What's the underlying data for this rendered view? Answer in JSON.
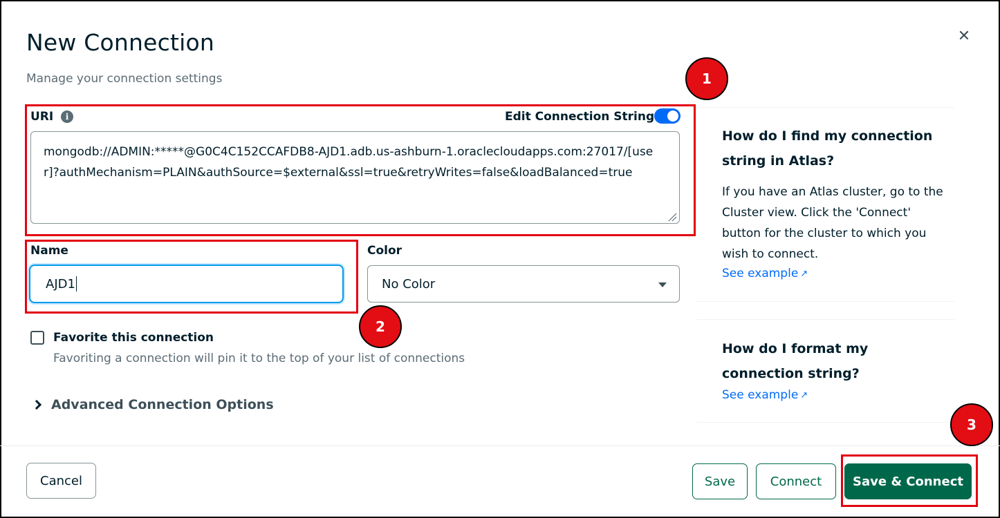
{
  "modal": {
    "title": "New Connection",
    "subtitle": "Manage your connection settings",
    "close_icon": "close-icon"
  },
  "uri": {
    "label": "URI",
    "info_icon": "i",
    "edit_toggle_label": "Edit Connection String",
    "edit_toggle_on": true,
    "value": "mongodb://ADMIN:*****@G0C4C152CCAFDB8-AJD1.adb.us-ashburn-1.oraclecloudapps.com:27017/[user]?authMechanism=PLAIN&authSource=$external&ssl=true&retryWrites=false&loadBalanced=true"
  },
  "name": {
    "label": "Name",
    "value": "AJD1"
  },
  "color": {
    "label": "Color",
    "selected": "No Color"
  },
  "favorite": {
    "label": "Favorite this connection",
    "description": "Favoriting a connection will pin it to the top of your list of connections",
    "checked": false
  },
  "advanced": {
    "label": "Advanced Connection Options"
  },
  "help": [
    {
      "title": "How do I find my connection string in Atlas?",
      "text": "If you have an Atlas cluster, go to the Cluster view. Click the 'Connect' button for the cluster to which you wish to connect.",
      "link": "See example"
    },
    {
      "title": "How do I format my connection string?",
      "link": "See example"
    }
  ],
  "footer": {
    "cancel": "Cancel",
    "save": "Save",
    "connect": "Connect",
    "save_connect": "Save & Connect"
  },
  "annotations": {
    "badge1": "1",
    "badge2": "2",
    "badge3": "3",
    "color": "#e3000f"
  },
  "colors": {
    "primary": "#00684a",
    "link": "#016bf8",
    "toggle": "#016bf8",
    "focus": "#0498ec"
  }
}
